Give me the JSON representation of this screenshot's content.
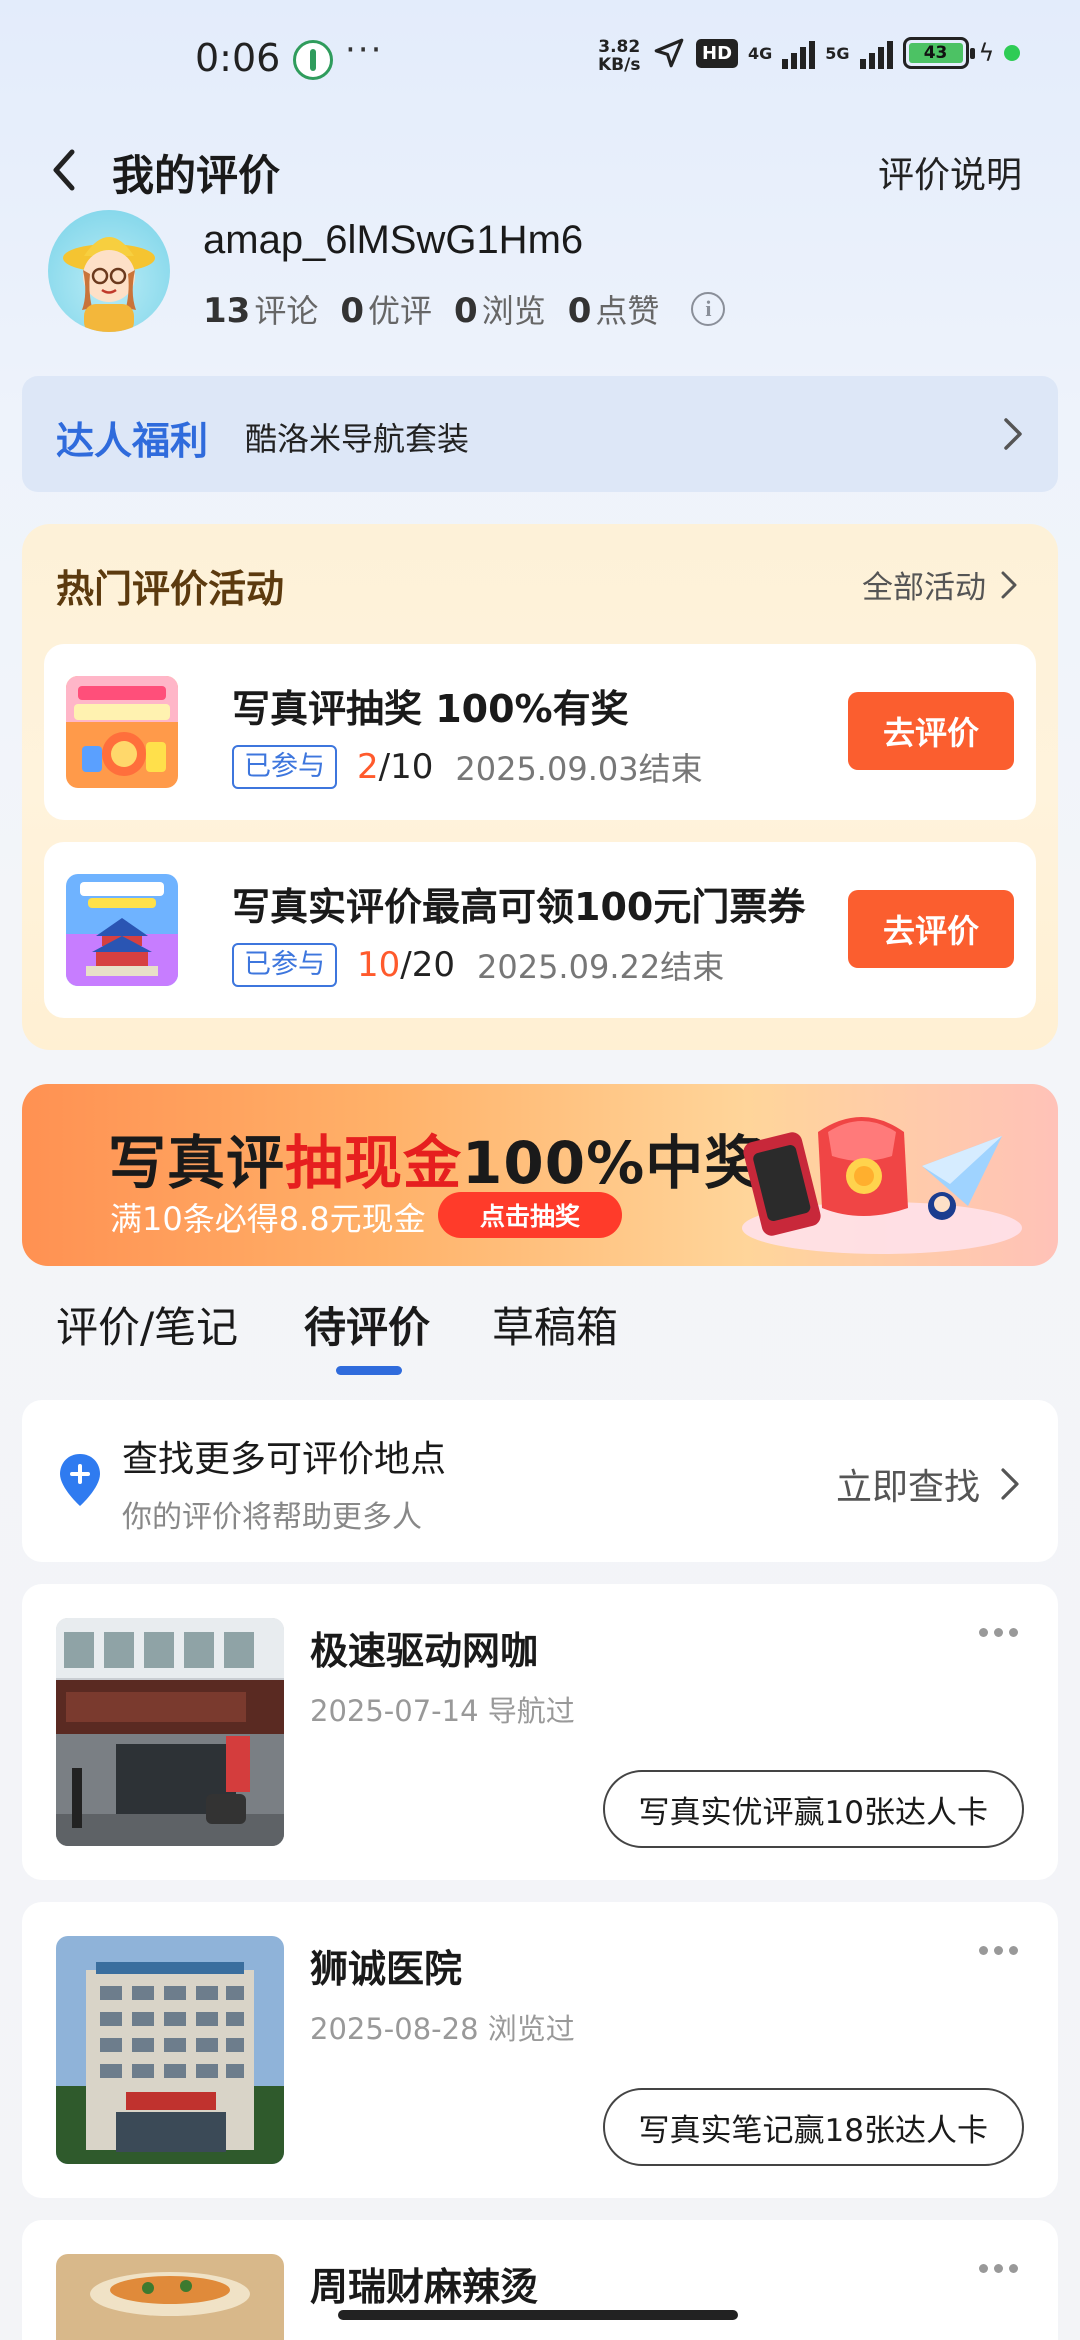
{
  "status_bar": {
    "time": "0:06",
    "more": "···",
    "speed_value": "3.82",
    "speed_unit": "KB/s",
    "hd": "HD",
    "net1": "4G",
    "net2": "5G",
    "battery": "43"
  },
  "header": {
    "title": "我的评价",
    "right_link": "评价说明"
  },
  "profile": {
    "username": "amap_6lMSwG1Hm6",
    "stats": [
      {
        "value": "13",
        "label": "评论"
      },
      {
        "value": "0",
        "label": "优评"
      },
      {
        "value": "0",
        "label": "浏览"
      },
      {
        "value": "0",
        "label": "点赞"
      }
    ],
    "info_icon": "i"
  },
  "benefit": {
    "title": "达人福利",
    "desc": "酷洛米导航套装"
  },
  "activities": {
    "title": "热门评价活动",
    "all_label": "全部活动",
    "items": [
      {
        "name": "写真评抽奖 100%有奖",
        "badge": "已参与",
        "progress_current": "2",
        "progress_total": "/10",
        "end": "2025.09.03结束",
        "button": "去评价"
      },
      {
        "name": "写真实评价最高可领100元门票券",
        "badge": "已参与",
        "progress_current": "10",
        "progress_total": "/20",
        "end": "2025.09.22结束",
        "button": "去评价"
      }
    ]
  },
  "banner": {
    "title_a": "写真评",
    "title_b": "抽现金",
    "title_c": "100%中奖",
    "subtitle": "满10条必得8.8元现金",
    "button": "点击抽奖"
  },
  "tabs": [
    "评价/笔记",
    "待评价",
    "草稿箱"
  ],
  "find": {
    "title": "查找更多可评价地点",
    "subtitle": "你的评价将帮助更多人",
    "link": "立即查找"
  },
  "places": [
    {
      "name": "极速驱动网咖",
      "meta": "2025-07-14 导航过",
      "button": "写真实优评赢10张达人卡"
    },
    {
      "name": "狮诚医院",
      "meta": "2025-08-28 浏览过",
      "button": "写真实笔记赢18张达人卡"
    },
    {
      "name": "周瑞财麻辣烫",
      "meta": "",
      "button": ""
    }
  ],
  "colors": {
    "accent_blue": "#2f6bdc",
    "action_orange": "#fb5e2f",
    "progress_red": "#ff5a2c"
  }
}
